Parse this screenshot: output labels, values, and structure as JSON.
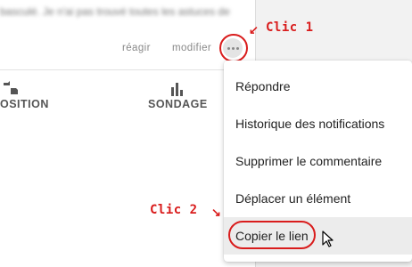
{
  "comment": {
    "blurred_text": "basculé. Je n'ai pas trouvé toutes les astuces de",
    "actions": {
      "react_label": "réagir",
      "edit_label": "modifier"
    },
    "more_icon": "more-horizontal-icon"
  },
  "tabs": [
    {
      "label": "OSITION",
      "icon": "thumbs-icon"
    },
    {
      "label": "SONDAGE",
      "icon": "bar-chart-icon"
    }
  ],
  "annotations": {
    "click1": "Clic 1",
    "click2": "Clic 2",
    "color": "#d91c1c"
  },
  "menu": {
    "items": [
      {
        "label": "Répondre"
      },
      {
        "label": "Historique des notifications"
      },
      {
        "label": "Supprimer le commentaire"
      },
      {
        "label": "Déplacer un élément"
      },
      {
        "label": "Copier le lien"
      }
    ],
    "hovered_item": "Copier le lien"
  },
  "cursor_icon": "mouse-pointer-icon"
}
